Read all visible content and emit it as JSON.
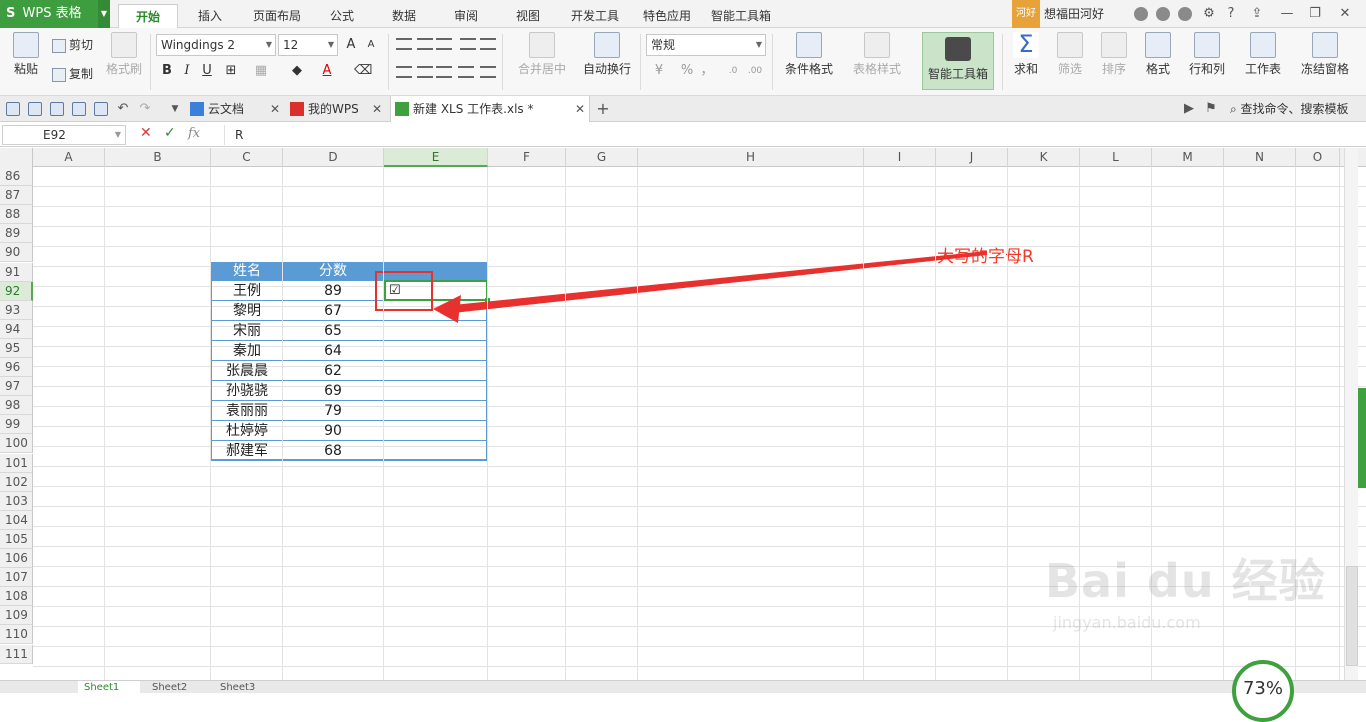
{
  "app": {
    "name": "WPS 表格",
    "logo": "S"
  },
  "menu": {
    "tabs": [
      "开始",
      "插入",
      "页面布局",
      "公式",
      "数据",
      "审阅",
      "视图",
      "开发工具",
      "特色应用",
      "智能工具箱"
    ],
    "active": "开始"
  },
  "user": {
    "badge": "河好",
    "name": "想福田河好"
  },
  "ribbon": {
    "paste": "粘贴",
    "cut": "剪切",
    "copy": "复制",
    "format_painter": "格式刷",
    "font_name": "Wingdings 2",
    "font_size": "12",
    "bold": "B",
    "italic": "I",
    "underline": "U",
    "font_color_glyph": "A",
    "merge_center": "合并居中",
    "wrap_text": "自动换行",
    "number_format": "常规",
    "percent": "%",
    "thousands": "，",
    "cond_format": "条件格式",
    "table_style": "表格样式",
    "smart_toolbox": "智能工具箱",
    "sum": "求和",
    "filter": "筛选",
    "sort": "排序",
    "format": "格式",
    "row_col": "行和列",
    "worksheet": "工作表",
    "freeze": "冻结窗格"
  },
  "doc_tabs": [
    {
      "label": "云文档"
    },
    {
      "label": "我的WPS"
    },
    {
      "label": "新建 XLS 工作表.xls *"
    }
  ],
  "search_cmd": "查找命令、搜索模板",
  "formula_bar": {
    "name_box": "E92",
    "fx": "fx",
    "value": "R",
    "cancel": "✕",
    "confirm": "✓"
  },
  "columns": [
    "A",
    "B",
    "C",
    "D",
    "E",
    "F",
    "G",
    "H",
    "I",
    "J",
    "K",
    "L",
    "M",
    "N",
    "O"
  ],
  "rows": [
    "86",
    "87",
    "88",
    "89",
    "90",
    "91",
    "92",
    "93",
    "94",
    "95",
    "96",
    "97",
    "98",
    "99",
    "100",
    "101",
    "102",
    "103",
    "104",
    "105",
    "106",
    "107",
    "108",
    "109",
    "110",
    "111"
  ],
  "table": {
    "headers": [
      "姓名",
      "分数"
    ],
    "rows": [
      {
        "name": "王例",
        "score": "89"
      },
      {
        "name": "黎明",
        "score": "67"
      },
      {
        "name": "宋丽",
        "score": "65"
      },
      {
        "name": "秦加",
        "score": "64"
      },
      {
        "name": "张晨晨",
        "score": "62"
      },
      {
        "name": "孙骁骁",
        "score": "69"
      },
      {
        "name": "袁丽丽",
        "score": "79"
      },
      {
        "name": "杜婷婷",
        "score": "90"
      },
      {
        "name": "郝建军",
        "score": "68"
      }
    ],
    "checkbox_glyph": "☑"
  },
  "annotation": "大写的字母R",
  "sheets": [
    "Sheet1",
    "Sheet2",
    "Sheet3"
  ],
  "zoom": "73%",
  "watermark": {
    "brand": "Bai du 经验",
    "url": "jingyan.baidu.com"
  },
  "colors": {
    "accent": "#3ea03e",
    "table_header": "#5b9bd5",
    "annotation": "#f03a2a"
  }
}
